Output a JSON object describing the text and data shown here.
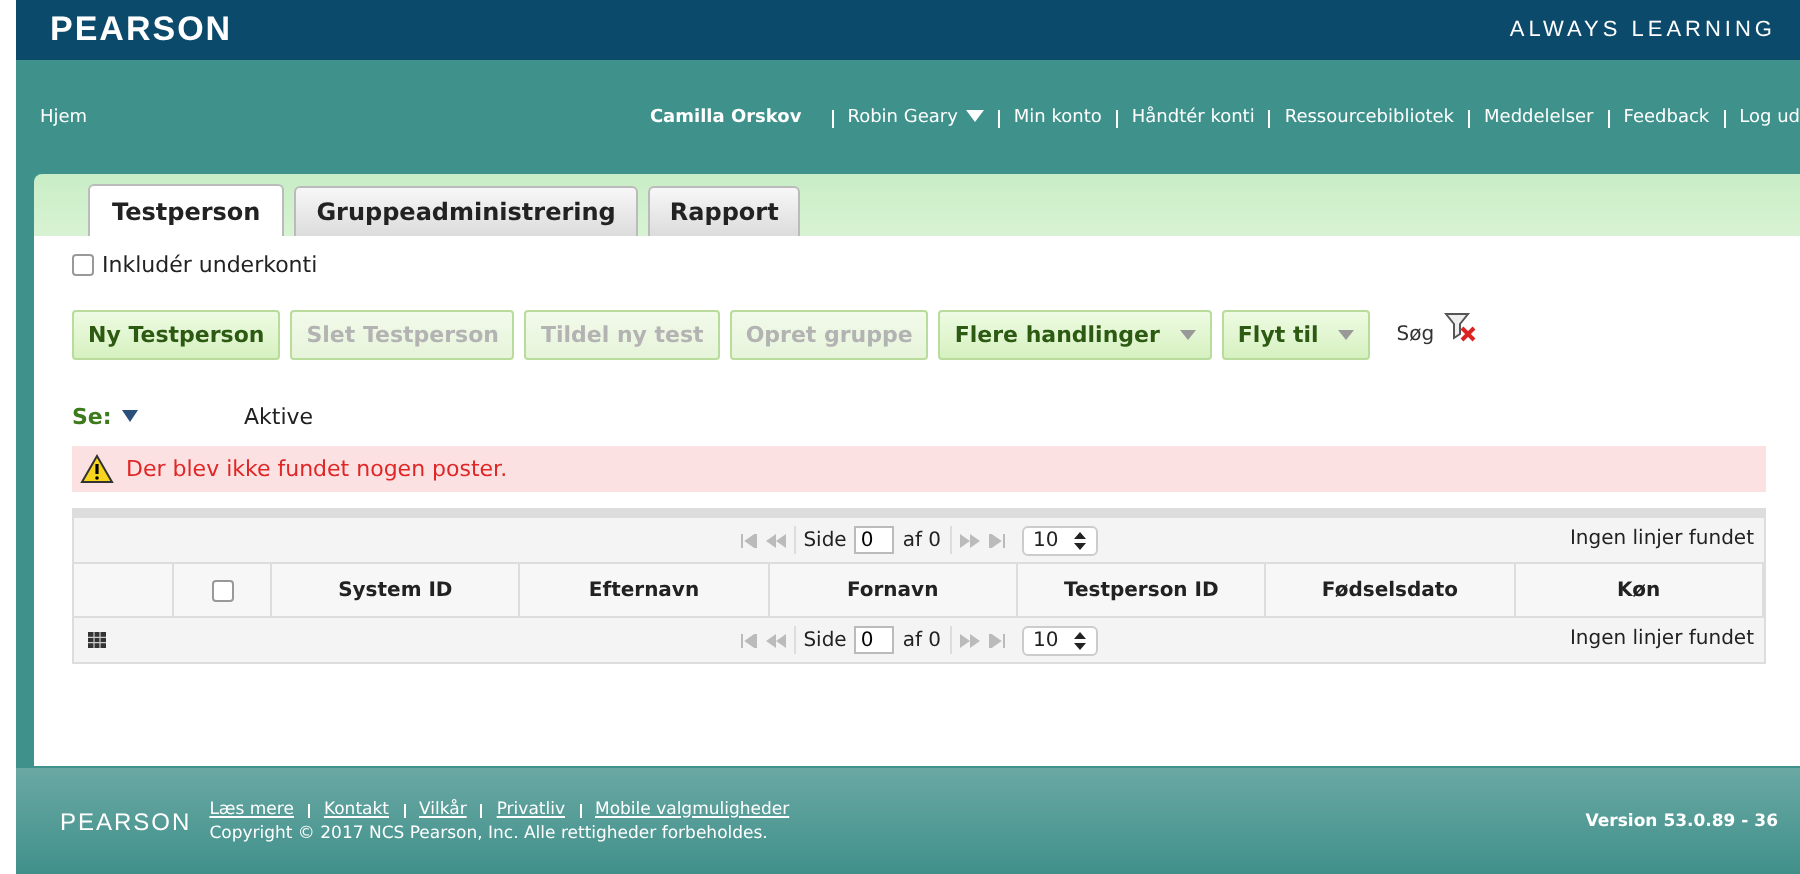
{
  "header": {
    "logo": "PEARSON",
    "tagline": "ALWAYS LEARNING"
  },
  "nav": {
    "home": "Hjem",
    "user": "Camilla Orskov",
    "links": [
      {
        "label": "Robin Geary",
        "dropdown": true
      },
      {
        "label": "Min konto",
        "dropdown": false
      },
      {
        "label": "Håndtér konti",
        "dropdown": false
      },
      {
        "label": "Ressourcebibliotek",
        "dropdown": false
      },
      {
        "label": "Meddelelser",
        "dropdown": false
      },
      {
        "label": "Feedback",
        "dropdown": false
      },
      {
        "label": "Log ud",
        "dropdown": false
      }
    ]
  },
  "tabs": [
    {
      "label": "Testperson",
      "selected": true
    },
    {
      "label": "Gruppeadministrering",
      "selected": false
    },
    {
      "label": "Rapport",
      "selected": false
    }
  ],
  "include_subaccounts": {
    "label": "Inkludér underkonti",
    "checked": false
  },
  "actions": [
    {
      "label": "Ny Testperson",
      "disabled": false,
      "dropdown": false
    },
    {
      "label": "Slet Testperson",
      "disabled": true,
      "dropdown": false
    },
    {
      "label": "Tildel ny test",
      "disabled": true,
      "dropdown": false
    },
    {
      "label": "Opret gruppe",
      "disabled": true,
      "dropdown": false
    },
    {
      "label": "Flere handlinger",
      "disabled": false,
      "dropdown": true
    },
    {
      "label": "Flyt til",
      "disabled": false,
      "dropdown": true
    }
  ],
  "search": {
    "label": "Søg"
  },
  "view": {
    "label": "Se:",
    "value": "Aktive"
  },
  "alert": {
    "message": "Der blev ikke fundet nogen poster."
  },
  "pagers": [
    {
      "page_label": "Side",
      "page": "0",
      "of": "af 0",
      "size": "10",
      "status": "Ingen linjer fundet"
    },
    {
      "page_label": "Side",
      "page": "0",
      "of": "af 0",
      "size": "10",
      "status": "Ingen linjer fundet"
    }
  ],
  "table": {
    "select_all_checked": false,
    "columns": [
      "System ID",
      "Efternavn",
      "Fornavn",
      "Testperson ID",
      "Fødselsdato",
      "Køn"
    ]
  },
  "footer": {
    "logo": "PEARSON",
    "links": [
      "Læs mere",
      "Kontakt",
      "Vilkår",
      "Privatliv",
      "Mobile valgmuligheder"
    ],
    "copyright": "Copyright © 2017 NCS Pearson, Inc. Alle rettigheder forbeholdes.",
    "version": "Version 53.0.89 - 36"
  }
}
